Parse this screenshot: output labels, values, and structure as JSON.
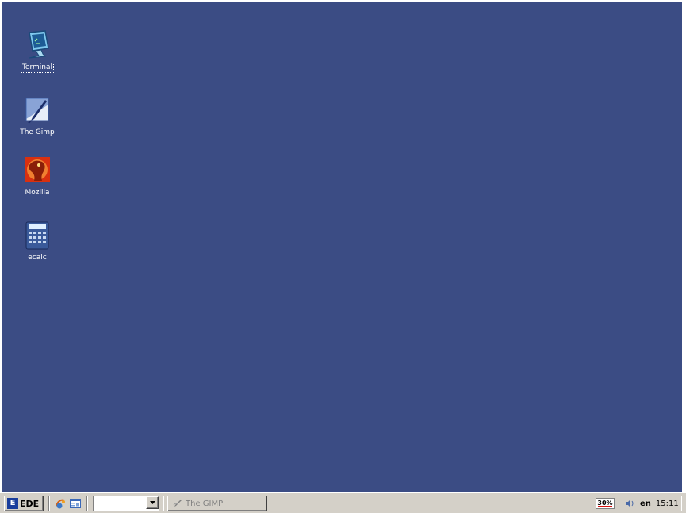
{
  "desktop": {
    "background_color": "#3b4c84",
    "icons": [
      {
        "label": "Terminal",
        "icon": "terminal-icon"
      },
      {
        "label": "The Gimp",
        "icon": "gimp-icon"
      },
      {
        "label": "Mozilla",
        "icon": "mozilla-icon"
      },
      {
        "label": "ecalc",
        "icon": "calculator-icon"
      }
    ]
  },
  "taskbar": {
    "start_label": "EDE",
    "quick_launch": [
      "browser-icon",
      "show-desktop-icon"
    ],
    "workspace_value": "",
    "tasks": [
      {
        "label": "The GIMP",
        "icon": "gimp-icon"
      }
    ],
    "tray": {
      "cpu": "30%",
      "language": "en",
      "clock": "15:11"
    }
  }
}
